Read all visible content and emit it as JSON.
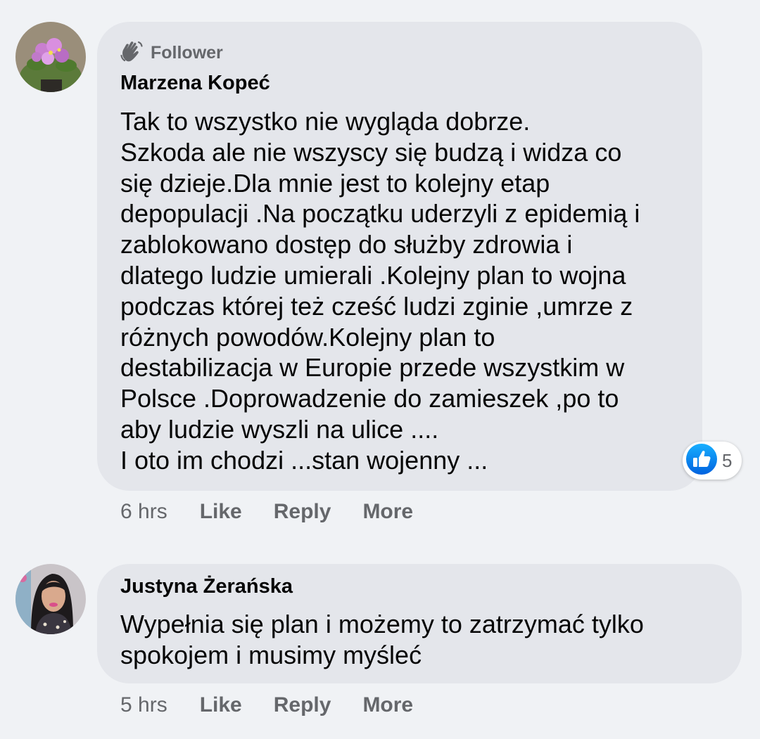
{
  "comments": [
    {
      "badge": "Follower",
      "author": "Marzena Kopeć",
      "lines": [
        "Tak to wszystko nie wygląda dobrze.",
        "Szkoda ale nie wszyscy się budzą i widza co",
        "się dzieje.Dla mnie jest to kolejny etap",
        "depopulacji .Na początku uderzyli z epidemią i",
        "zablokowano dostęp do służby zdrowia i",
        "dlatego ludzie umierali .Kolejny plan to wojna",
        "podczas której też cześć ludzi zginie ,umrze z",
        "różnych powodów.Kolejny plan to",
        "destabilizacja w Europie przede wszystkim w",
        "Polsce .Doprowadzenie do zamieszek ,po to",
        "aby ludzie wyszli na ulice ....",
        "I oto im chodzi ...stan wojenny ..."
      ],
      "reaction_count": "5",
      "time": "6 hrs",
      "actions": {
        "like": "Like",
        "reply": "Reply",
        "more": "More"
      }
    },
    {
      "author": "Justyna Żerańska",
      "lines": [
        "Wypełnia się plan i możemy to zatrzymać tylko",
        "spokojem i musimy myśleć"
      ],
      "time": "5 hrs",
      "actions": {
        "like": "Like",
        "reply": "Reply",
        "more": "More"
      }
    }
  ],
  "colors": {
    "background": "#f0f2f5",
    "bubble": "#e4e6eb",
    "text": "#050505",
    "secondary_text": "#65676b",
    "like_blue": "#1877f2"
  },
  "icons": {
    "badge": "waving-hand-icon",
    "reaction": "thumbs-up-icon"
  }
}
